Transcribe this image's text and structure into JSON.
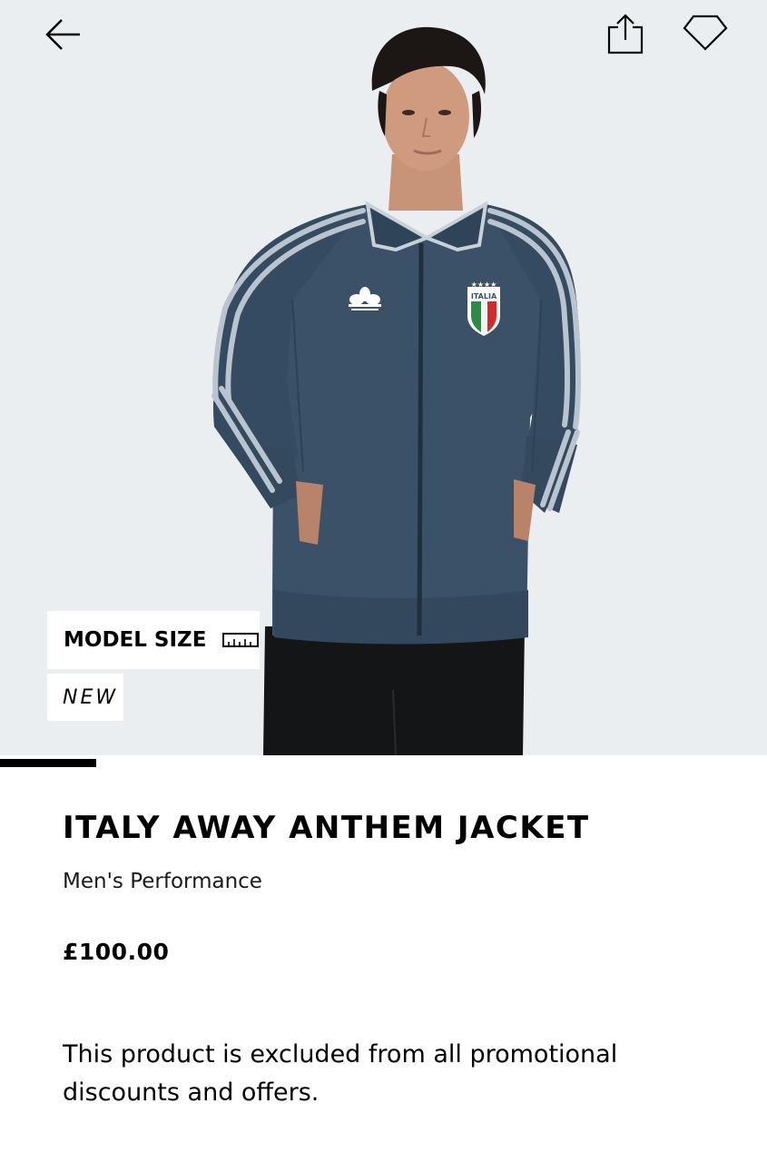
{
  "header": {
    "back_icon": "arrow-left-icon",
    "share_icon": "share-icon",
    "wishlist_icon": "heart-icon"
  },
  "hero": {
    "image_alt": "Model wearing Italy Away Anthem Jacket",
    "jacket_color": "#3a5168",
    "stripe_color": "#b9c4cf",
    "background_color": "#eaeef0",
    "badge_text": "ITALIA",
    "model_size_label": "MODEL SIZE",
    "model_size_icon": "ruler-icon",
    "new_label": "NEW"
  },
  "gallery": {
    "progress_fraction": 0.125
  },
  "product": {
    "title": "ITALY AWAY ANTHEM JACKET",
    "category": "Men's Performance",
    "price": "£100.00",
    "promo_note": "This product is excluded from all promotional discounts and offers."
  }
}
